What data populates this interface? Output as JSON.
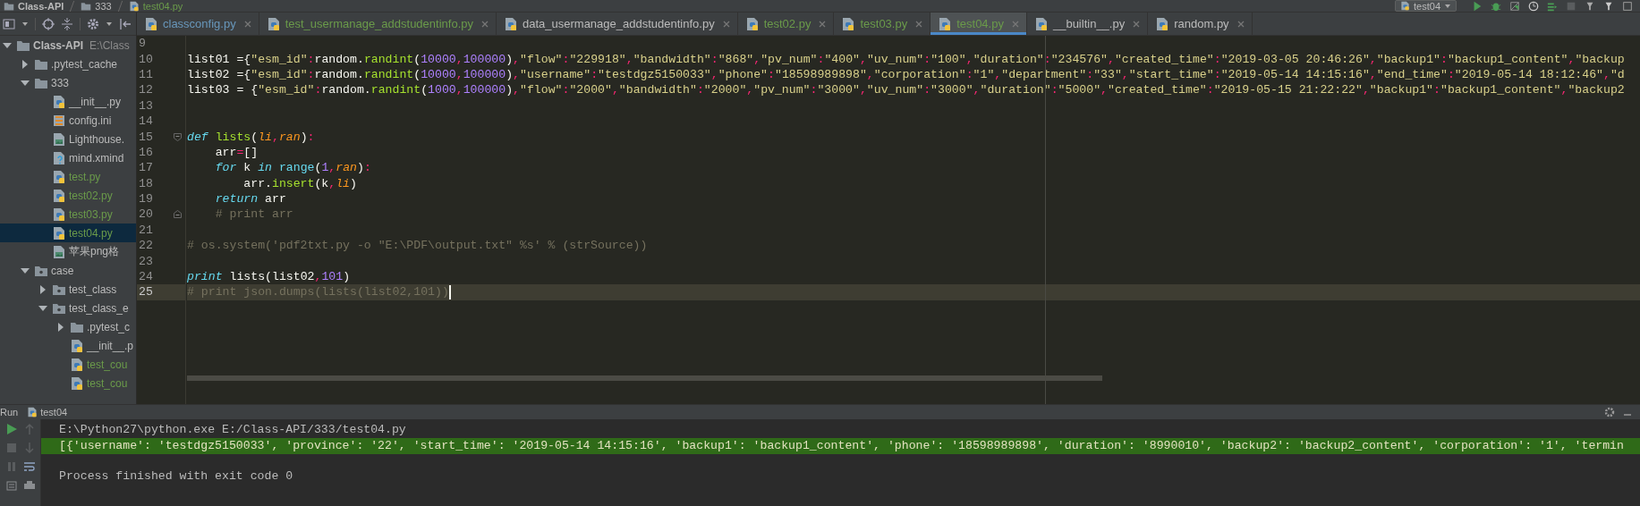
{
  "breadcrumb": [
    {
      "label": "Class-API",
      "kind": "project"
    },
    {
      "label": "333",
      "kind": "folder"
    },
    {
      "label": "test04.py",
      "kind": "python",
      "color": "#6a9a4a"
    }
  ],
  "run_config": {
    "label": "test04"
  },
  "tabs": [
    {
      "label": "classconfig.py",
      "color": "#6897bb",
      "selected": false
    },
    {
      "label": "test_usermanage_addstudentinfo.py",
      "color": "#6a9a4a",
      "selected": false
    },
    {
      "label": "data_usermanage_addstudentinfo.py",
      "color": "#bbbbbb",
      "selected": false
    },
    {
      "label": "test02.py",
      "color": "#6a9a4a",
      "selected": false
    },
    {
      "label": "test03.py",
      "color": "#6a9a4a",
      "selected": false
    },
    {
      "label": "test04.py",
      "color": "#6a9a4a",
      "selected": true
    },
    {
      "label": "__builtin__.py",
      "color": "#bbbbbb",
      "selected": false
    },
    {
      "label": "random.py",
      "color": "#bbbbbb",
      "selected": false
    }
  ],
  "project_tree": [
    {
      "name": "Class-API",
      "path": "E:\\Class",
      "kind": "project",
      "expanded": true,
      "selected": false,
      "color": "#bbbbbb",
      "children": [
        {
          "name": ".pytest_cache",
          "kind": "folder",
          "expanded": false,
          "selected": false,
          "color": "#bbbbbb"
        },
        {
          "name": "333",
          "kind": "folder",
          "expanded": true,
          "selected": false,
          "color": "#bbbbbb",
          "children": [
            {
              "name": "__init__.py",
              "kind": "python",
              "selected": false,
              "color": "#bbbbbb"
            },
            {
              "name": "config.ini",
              "kind": "ini",
              "selected": false,
              "color": "#bbbbbb"
            },
            {
              "name": "Lighthouse.",
              "kind": "image",
              "selected": false,
              "color": "#bbbbbb"
            },
            {
              "name": "mind.xmind",
              "kind": "unknown",
              "selected": false,
              "color": "#bbbbbb"
            },
            {
              "name": "test.py",
              "kind": "python",
              "selected": false,
              "color": "#6a9a4a"
            },
            {
              "name": "test02.py",
              "kind": "python",
              "selected": false,
              "color": "#6a9a4a"
            },
            {
              "name": "test03.py",
              "kind": "python",
              "selected": false,
              "color": "#6a9a4a"
            },
            {
              "name": "test04.py",
              "kind": "python",
              "selected": true,
              "color": "#6a9a4a"
            },
            {
              "name": "苹果png格",
              "kind": "image",
              "selected": false,
              "color": "#bbbbbb"
            }
          ]
        },
        {
          "name": "case",
          "kind": "package",
          "expanded": true,
          "selected": false,
          "color": "#bbbbbb",
          "children": [
            {
              "name": "test_class",
              "kind": "package",
              "expanded": false,
              "selected": false,
              "color": "#bbbbbb"
            },
            {
              "name": "test_class_e",
              "kind": "package",
              "expanded": true,
              "selected": false,
              "color": "#bbbbbb",
              "children": [
                {
                  "name": ".pytest_c",
                  "kind": "folder",
                  "expanded": false,
                  "selected": false,
                  "color": "#bbbbbb"
                },
                {
                  "name": "__init__.p",
                  "kind": "python",
                  "selected": false,
                  "color": "#bbbbbb"
                },
                {
                  "name": "test_cou",
                  "kind": "python",
                  "selected": false,
                  "color": "#6a9a4a"
                },
                {
                  "name": "test_cou",
                  "kind": "python",
                  "selected": false,
                  "color": "#6a9a4a"
                }
              ]
            }
          ]
        }
      ]
    }
  ],
  "editor": {
    "lines": [
      {
        "number": "9",
        "current": false
      },
      {
        "number": "10",
        "current": false,
        "tokens": [
          {
            "kind": "plain",
            "text": "list01 ={"
          },
          {
            "kind": "string",
            "text": "\"esm_id\""
          },
          {
            "kind": "op",
            "text": ":"
          },
          {
            "kind": "plain",
            "text": "random."
          },
          {
            "kind": "call",
            "text": "randint"
          },
          {
            "kind": "plain",
            "text": "("
          },
          {
            "kind": "number",
            "text": "10000"
          },
          {
            "kind": "op",
            "text": ","
          },
          {
            "kind": "number",
            "text": "100000"
          },
          {
            "kind": "plain",
            "text": ")"
          },
          {
            "kind": "op",
            "text": ","
          },
          {
            "kind": "string",
            "text": "\"flow\""
          },
          {
            "kind": "op",
            "text": ":"
          },
          {
            "kind": "string",
            "text": "\"229918\""
          },
          {
            "kind": "op",
            "text": ","
          },
          {
            "kind": "string",
            "text": "\"bandwidth\""
          },
          {
            "kind": "op",
            "text": ":"
          },
          {
            "kind": "string",
            "text": "\"868\""
          },
          {
            "kind": "op",
            "text": ","
          },
          {
            "kind": "string",
            "text": "\"pv_num\""
          },
          {
            "kind": "op",
            "text": ":"
          },
          {
            "kind": "string",
            "text": "\"400\""
          },
          {
            "kind": "op",
            "text": ","
          },
          {
            "kind": "string",
            "text": "\"uv_num\""
          },
          {
            "kind": "op",
            "text": ":"
          },
          {
            "kind": "string",
            "text": "\"100\""
          },
          {
            "kind": "op",
            "text": ","
          },
          {
            "kind": "string",
            "text": "\"duration\""
          },
          {
            "kind": "op",
            "text": ":"
          },
          {
            "kind": "string",
            "text": "\"234576\""
          },
          {
            "kind": "op",
            "text": ","
          },
          {
            "kind": "string",
            "text": "\"created_time\""
          },
          {
            "kind": "op",
            "text": ":"
          },
          {
            "kind": "string",
            "text": "\"2019-03-05 20:46:26\""
          },
          {
            "kind": "op",
            "text": ","
          },
          {
            "kind": "string",
            "text": "\"backup1\""
          },
          {
            "kind": "op",
            "text": ":"
          },
          {
            "kind": "string",
            "text": "\"backup1_content\""
          },
          {
            "kind": "op",
            "text": ","
          },
          {
            "kind": "string",
            "text": "\"backup"
          }
        ]
      },
      {
        "number": "11",
        "current": false,
        "tokens": [
          {
            "kind": "plain",
            "text": "list02 ={"
          },
          {
            "kind": "string",
            "text": "\"esm_id\""
          },
          {
            "kind": "op",
            "text": ":"
          },
          {
            "kind": "plain",
            "text": "random."
          },
          {
            "kind": "call",
            "text": "randint"
          },
          {
            "kind": "plain",
            "text": "("
          },
          {
            "kind": "number",
            "text": "10000"
          },
          {
            "kind": "op",
            "text": ","
          },
          {
            "kind": "number",
            "text": "100000"
          },
          {
            "kind": "plain",
            "text": ")"
          },
          {
            "kind": "op",
            "text": ","
          },
          {
            "kind": "string",
            "text": "\"username\""
          },
          {
            "kind": "op",
            "text": ":"
          },
          {
            "kind": "string",
            "text": "\"testdgz5150033\""
          },
          {
            "kind": "op",
            "text": ","
          },
          {
            "kind": "string",
            "text": "\"phone\""
          },
          {
            "kind": "op",
            "text": ":"
          },
          {
            "kind": "string",
            "text": "\"18598989898\""
          },
          {
            "kind": "op",
            "text": ","
          },
          {
            "kind": "string",
            "text": "\"corporation\""
          },
          {
            "kind": "op",
            "text": ":"
          },
          {
            "kind": "string",
            "text": "\"1\""
          },
          {
            "kind": "op",
            "text": ","
          },
          {
            "kind": "string",
            "text": "\"department\""
          },
          {
            "kind": "op",
            "text": ":"
          },
          {
            "kind": "string",
            "text": "\"33\""
          },
          {
            "kind": "op",
            "text": ","
          },
          {
            "kind": "string",
            "text": "\"start_time\""
          },
          {
            "kind": "op",
            "text": ":"
          },
          {
            "kind": "string",
            "text": "\"2019-05-14 14:15:16\""
          },
          {
            "kind": "op",
            "text": ","
          },
          {
            "kind": "string",
            "text": "\"end_time\""
          },
          {
            "kind": "op",
            "text": ":"
          },
          {
            "kind": "string",
            "text": "\"2019-05-14 18:12:46\""
          },
          {
            "kind": "op",
            "text": ","
          },
          {
            "kind": "string",
            "text": "\"d"
          }
        ]
      },
      {
        "number": "12",
        "current": false,
        "tokens": [
          {
            "kind": "plain",
            "text": "list03 = {"
          },
          {
            "kind": "string",
            "text": "\"esm_id\""
          },
          {
            "kind": "op",
            "text": ":"
          },
          {
            "kind": "plain",
            "text": "random."
          },
          {
            "kind": "call",
            "text": "randint"
          },
          {
            "kind": "plain",
            "text": "("
          },
          {
            "kind": "number",
            "text": "1000"
          },
          {
            "kind": "op",
            "text": ","
          },
          {
            "kind": "number",
            "text": "100000"
          },
          {
            "kind": "plain",
            "text": ")"
          },
          {
            "kind": "op",
            "text": ","
          },
          {
            "kind": "string",
            "text": "\"flow\""
          },
          {
            "kind": "op",
            "text": ":"
          },
          {
            "kind": "string",
            "text": "\"2000\""
          },
          {
            "kind": "op",
            "text": ","
          },
          {
            "kind": "string",
            "text": "\"bandwidth\""
          },
          {
            "kind": "op",
            "text": ":"
          },
          {
            "kind": "string",
            "text": "\"2000\""
          },
          {
            "kind": "op",
            "text": ","
          },
          {
            "kind": "string",
            "text": "\"pv_num\""
          },
          {
            "kind": "op",
            "text": ":"
          },
          {
            "kind": "string",
            "text": "\"3000\""
          },
          {
            "kind": "op",
            "text": ","
          },
          {
            "kind": "string",
            "text": "\"uv_num\""
          },
          {
            "kind": "op",
            "text": ":"
          },
          {
            "kind": "string",
            "text": "\"3000\""
          },
          {
            "kind": "op",
            "text": ","
          },
          {
            "kind": "string",
            "text": "\"duration\""
          },
          {
            "kind": "op",
            "text": ":"
          },
          {
            "kind": "string",
            "text": "\"5000\""
          },
          {
            "kind": "op",
            "text": ","
          },
          {
            "kind": "string",
            "text": "\"created_time\""
          },
          {
            "kind": "op",
            "text": ":"
          },
          {
            "kind": "string",
            "text": "\"2019-05-15 21:22:22\""
          },
          {
            "kind": "op",
            "text": ","
          },
          {
            "kind": "string",
            "text": "\"backup1\""
          },
          {
            "kind": "op",
            "text": ":"
          },
          {
            "kind": "string",
            "text": "\"backup1_content\""
          },
          {
            "kind": "op",
            "text": ","
          },
          {
            "kind": "string",
            "text": "\"backup2"
          }
        ]
      },
      {
        "number": "13",
        "current": false
      },
      {
        "number": "14",
        "current": false
      },
      {
        "number": "15",
        "current": false,
        "fold_start": true,
        "fold_end": false,
        "tokens": [
          {
            "kind": "keyword",
            "text": "def"
          },
          {
            "kind": "call",
            "text": " lists"
          },
          {
            "kind": "plain",
            "text": "("
          },
          {
            "kind": "param",
            "text": "li"
          },
          {
            "kind": "op",
            "text": ","
          },
          {
            "kind": "param",
            "text": "ran"
          },
          {
            "kind": "plain",
            "text": ")"
          },
          {
            "kind": "op",
            "text": ":"
          }
        ]
      },
      {
        "number": "16",
        "current": false,
        "tokens": [
          {
            "kind": "plain",
            "text": "    arr"
          },
          {
            "kind": "op",
            "text": "="
          },
          {
            "kind": "plain",
            "text": "[]"
          }
        ]
      },
      {
        "number": "17",
        "current": false,
        "tokens": [
          {
            "kind": "keyword",
            "text": "    for"
          },
          {
            "kind": "plain",
            "text": " k "
          },
          {
            "kind": "keyword",
            "text": "in"
          },
          {
            "kind": "builtin",
            "text": " range"
          },
          {
            "kind": "plain",
            "text": "("
          },
          {
            "kind": "number",
            "text": "1"
          },
          {
            "kind": "op",
            "text": ","
          },
          {
            "kind": "param",
            "text": "ran"
          },
          {
            "kind": "plain",
            "text": ")"
          },
          {
            "kind": "op",
            "text": ":"
          }
        ]
      },
      {
        "number": "18",
        "current": false,
        "tokens": [
          {
            "kind": "plain",
            "text": "        arr."
          },
          {
            "kind": "call",
            "text": "insert"
          },
          {
            "kind": "plain",
            "text": "(k"
          },
          {
            "kind": "op",
            "text": ","
          },
          {
            "kind": "param",
            "text": "li"
          },
          {
            "kind": "plain",
            "text": ")"
          }
        ]
      },
      {
        "number": "19",
        "current": false,
        "tokens": [
          {
            "kind": "keyword",
            "text": "    return"
          },
          {
            "kind": "plain",
            "text": " arr"
          }
        ]
      },
      {
        "number": "20",
        "current": false,
        "fold_start": false,
        "fold_end": true,
        "tokens": [
          {
            "kind": "comment",
            "text": "    # print arr"
          }
        ]
      },
      {
        "number": "21",
        "current": false
      },
      {
        "number": "22",
        "current": false,
        "tokens": [
          {
            "kind": "comment",
            "text": "# os.system('pdf2txt.py -o \"E:\\PDF\\output.txt\" %s' % (strSource))"
          }
        ]
      },
      {
        "number": "23",
        "current": false
      },
      {
        "number": "24",
        "current": false,
        "tokens": [
          {
            "kind": "keyword",
            "text": "print"
          },
          {
            "kind": "plain",
            "text": " lists(list02"
          },
          {
            "kind": "op",
            "text": ","
          },
          {
            "kind": "number",
            "text": "101"
          },
          {
            "kind": "plain",
            "text": ")"
          }
        ]
      },
      {
        "number": "25",
        "current": true,
        "tokens": [
          {
            "kind": "comment",
            "text": "# print json.dumps(lists(list02,101))"
          }
        ]
      }
    ]
  },
  "run_panel": {
    "title": "Run",
    "tab": "test04",
    "console": [
      {
        "kind": "command",
        "text": "E:\\Python27\\python.exe E:/Class-API/333/test04.py"
      },
      {
        "kind": "output",
        "text": "[{'username': 'testdgz5150033', 'province': '22', 'start_time': '2019-05-14 14:15:16', 'backup1': 'backup1_content', 'phone': '18598989898', 'duration': '8990010', 'backup2': 'backup2_content', 'corporation': '1', 'termin"
      },
      {
        "kind": "status",
        "text": "Process finished with exit code 0"
      }
    ]
  }
}
